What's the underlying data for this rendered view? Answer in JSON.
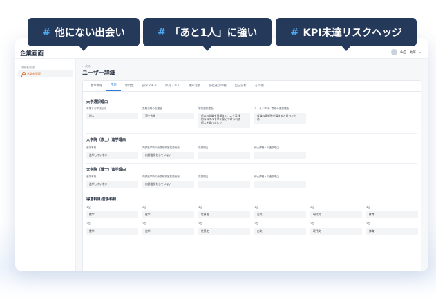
{
  "app": {
    "company_title": "企業画面",
    "user_name": "山田　太郎",
    "sidebar_section": "詳細者管理",
    "sidebar_item": "求職者管理"
  },
  "page": {
    "back": "← 戻る",
    "title": "ユーザー詳細"
  },
  "tabs": [
    "基本情報",
    "学歴",
    "専門性",
    "語学スキル",
    "保有スキル",
    "課外活動",
    "会社選びの軸",
    "自己分析",
    "その他"
  ],
  "active_tab": "学歴",
  "sections": {
    "univ": {
      "title": "大学選択理由",
      "fields": [
        {
          "label": "卒業する学校区分",
          "value": "短大"
        },
        {
          "label": "受験当時の志望度",
          "value": "第一志望"
        },
        {
          "label": "学校選択理由",
          "value": "日本の就職を見据えて、より実践\n的なスキルを早く身につけられる\n短大を選びました"
        },
        {
          "label": "コース／学科／専攻の選択理由",
          "value": "就職の選択肢が増えると思ったた\nめ"
        }
      ]
    },
    "master": {
      "title": "大学院（修士）進学理由",
      "fields": [
        {
          "label": "進学有無",
          "value": "進学していない"
        },
        {
          "label": "内部進学時の所属研究室変更有無",
          "value": "内部進学をしていない"
        },
        {
          "label": "変更理由",
          "value": ""
        },
        {
          "label": "博士課程への進学理由",
          "value": ""
        }
      ]
    },
    "doctor": {
      "title": "大学院（博士）進学理由",
      "fields": [
        {
          "label": "進学有無",
          "value": "進学していない"
        },
        {
          "label": "内部進学時の所属研究室変更有無",
          "value": "内部進学をしていない"
        },
        {
          "label": "変更理由",
          "value": ""
        },
        {
          "label": "博士課程への進学理由",
          "value": ""
        }
      ]
    },
    "subjects": {
      "title": "得意科目/苦手科目",
      "row1": [
        {
          "label": "1位",
          "value": "数学"
        },
        {
          "label": "2位",
          "value": "化学"
        },
        {
          "label": "3位",
          "value": "世界史"
        },
        {
          "label": "1位",
          "value": "古文"
        },
        {
          "label": "2位",
          "value": "現代文"
        },
        {
          "label": "3位",
          "value": "体育"
        }
      ],
      "row2": [
        {
          "label": "1位",
          "value": "数学"
        },
        {
          "label": "2位",
          "value": "化学"
        },
        {
          "label": "3位",
          "value": "世界史"
        },
        {
          "label": "1位",
          "value": "古文"
        },
        {
          "label": "2位",
          "value": "現代文"
        },
        {
          "label": "3位",
          "value": "体育"
        }
      ]
    }
  },
  "callouts": [
    {
      "hash": "#",
      "text": "他にない出会い"
    },
    {
      "hash": "#",
      "text": "「あと1人」に強い"
    },
    {
      "hash": "#",
      "text": "KPI未達リスクヘッジ"
    }
  ],
  "colors": {
    "accent": "#2f7ad6",
    "tag_bg": "#25395b",
    "hash": "#4ea8f0",
    "sidebar_active": "#e07b39"
  }
}
